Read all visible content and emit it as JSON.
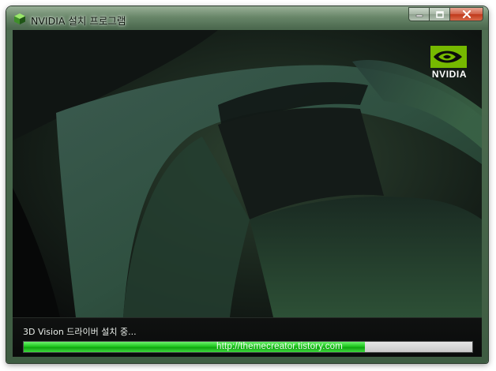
{
  "window": {
    "title": "NVIDIA 설치 프로그램",
    "controls": {
      "minimize": "minimize-icon",
      "maximize": "maximize-icon",
      "close": "close-icon"
    }
  },
  "logo": {
    "text": "NVIDIA"
  },
  "status": {
    "message": "3D Vision 드라이버 설치 중...",
    "progress": 0.76
  },
  "watermark": "http://themecreator.tistory.com",
  "colors": {
    "progress_fill": "#22c422",
    "nvidia_green": "#76b900",
    "frame": "#4f6e52"
  }
}
